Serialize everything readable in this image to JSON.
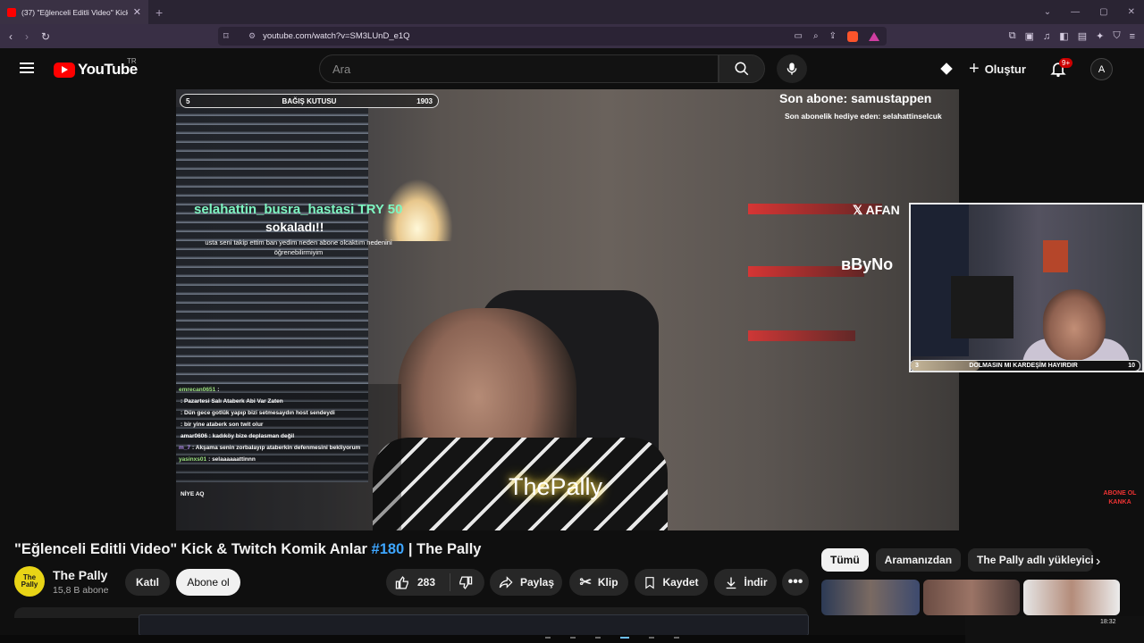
{
  "browser": {
    "tab_title": "(37) \"Eğlenceli Editli Video\" Kick",
    "new_tab": "+",
    "url": "youtube.com/watch?v=SM3LUnD_e1Q"
  },
  "header": {
    "logo_text": "YouTube",
    "country_code": "TR",
    "search_placeholder": "Ara",
    "create_label": "Oluştur",
    "notification_count": "9+",
    "avatar_letter": "A"
  },
  "video_overlay": {
    "donation_left": "5",
    "donation_label": "BAĞIŞ KUTUSU",
    "donation_right": "1903",
    "last_sub": "Son abone: samustappen",
    "last_gift": "Son abonelik hediye eden: selahattinselcuk",
    "alert_name": "selahattin_busra_hastasi TRY 50",
    "alert_title": "sokaladı!!",
    "alert_message": "usta seni takip ettim ban yedim neden abone olcaktım nedenini öğrenebilirmiyim",
    "sponsor1": "AFAN",
    "sponsor2": "ByNo",
    "watermark": "ThePally",
    "corner_text": "ABONE OL KANKA",
    "chat": [
      {
        "user": "emrecan0651",
        "msg": ":"
      },
      {
        "user": "",
        "msg": ": Pazartesi Salı Ataberk Abi Var Zaten"
      },
      {
        "user": "",
        "msg": ": Dün gece gotlük yapıp bizi setmesaydın host sendeydi"
      },
      {
        "user": "",
        "msg": ": bir yine ataberk son twit olur"
      },
      {
        "user": "",
        "msg": "amar0606 : kadıköy bize deplasman değil"
      },
      {
        "user": "m_7",
        "msg": ": Akşama senin zorbalayıp ataberkin defenmesini bekliyorum"
      },
      {
        "user": "yasinxs01",
        "msg": ": selaaaaaattinnn"
      },
      {
        "user": "",
        "msg": ""
      },
      {
        "user": "",
        "msg": ""
      },
      {
        "user": "",
        "msg": "NİYE AQ"
      }
    ]
  },
  "webcam": {
    "goal_left": "3",
    "goal_label": "DOLMASIN MI KARDEŞİM HAYIRDIR",
    "goal_right": "10",
    "goal_progress": 0.3
  },
  "video_info": {
    "title_prefix": "\"Eğlenceli Editli Video\" Kick & Twitch Komik Anlar ",
    "title_tag": "#180",
    "title_suffix": " | The Pally",
    "channel_name": "The Pally",
    "channel_avatar_text": "The Pally",
    "subscribers": "15,8 B abone",
    "join_label": "Katıl",
    "subscribe_label": "Abone ol",
    "likes": "283",
    "share_label": "Paylaş",
    "clip_label": "Klip",
    "save_label": "Kaydet",
    "download_label": "İndir"
  },
  "chips": [
    "Tümü",
    "Aramanızdan",
    "The Pally adlı yükleyiciden"
  ],
  "system": {
    "time": "18:32"
  }
}
